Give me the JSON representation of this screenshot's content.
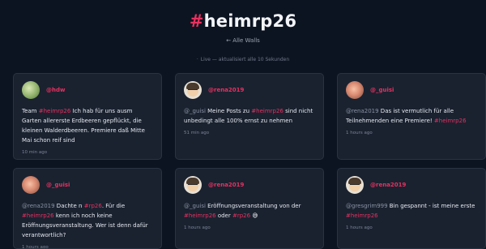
{
  "header": {
    "hash": "#",
    "name": "heimrp26",
    "back_label": "← Alle Walls",
    "status_dot": "·",
    "status_text": "Live — aktualisiert alle 10 Sekunden"
  },
  "posts": [
    {
      "user": "@hdw",
      "avatar": "avatar-hdw",
      "time": "10 min ago",
      "parts": [
        {
          "t": "Team ",
          "k": "text"
        },
        {
          "t": "#heimrp26",
          "k": "tag"
        },
        {
          "t": " Ich hab für uns ausm Garten allererste Erdbeeren gepflückt, die kleinen Walderdbeeren. Premiere daß Mitte Mai schon reif sind",
          "k": "text"
        }
      ]
    },
    {
      "user": "@rena2019",
      "avatar": "avatar-rena",
      "time": "51 min ago",
      "parts": [
        {
          "t": "@_guisi",
          "k": "mention"
        },
        {
          "t": " Meine Posts zu ",
          "k": "text"
        },
        {
          "t": "#heimrp26",
          "k": "tag"
        },
        {
          "t": " sind nicht unbedingt alle 100% ernst zu nehmen",
          "k": "text"
        }
      ]
    },
    {
      "user": "@_guisi",
      "avatar": "avatar-guisi",
      "time": "1 hours ago",
      "parts": [
        {
          "t": "@rena2019",
          "k": "mention"
        },
        {
          "t": " Das ist vermutlich für alle Teilnehmenden eine Premiere! ",
          "k": "text"
        },
        {
          "t": "#heimrp26",
          "k": "tag"
        }
      ]
    },
    {
      "user": "@_guisi",
      "avatar": "avatar-guisi",
      "time": "1 hours ago",
      "parts": [
        {
          "t": "@rena2019",
          "k": "mention"
        },
        {
          "t": " Dachte n ",
          "k": "text"
        },
        {
          "t": "#rp26",
          "k": "tag"
        },
        {
          "t": ". Für die ",
          "k": "text"
        },
        {
          "t": "#heimrp26",
          "k": "tag"
        },
        {
          "t": " kenn ich noch keine Eröffnungsveranstaltung. Wer ist denn dafür verantwortlich?",
          "k": "text"
        }
      ]
    },
    {
      "user": "@rena2019",
      "avatar": "avatar-rena",
      "time": "1 hours ago",
      "parts": [
        {
          "t": "@_guisi",
          "k": "mention"
        },
        {
          "t": " Eröffnungsveranstaltung von der ",
          "k": "text"
        },
        {
          "t": "#heimrp26",
          "k": "tag"
        },
        {
          "t": " oder ",
          "k": "text"
        },
        {
          "t": "#rp26",
          "k": "tag"
        },
        {
          "t": " 😅",
          "k": "text"
        }
      ]
    },
    {
      "user": "@rena2019",
      "avatar": "avatar-rena",
      "time": "1 hours ago",
      "parts": [
        {
          "t": "@gresgrim999",
          "k": "mention"
        },
        {
          "t": " Bin gespannt - ist meine erste ",
          "k": "text"
        },
        {
          "t": "#heimrp26",
          "k": "tag"
        }
      ]
    }
  ]
}
